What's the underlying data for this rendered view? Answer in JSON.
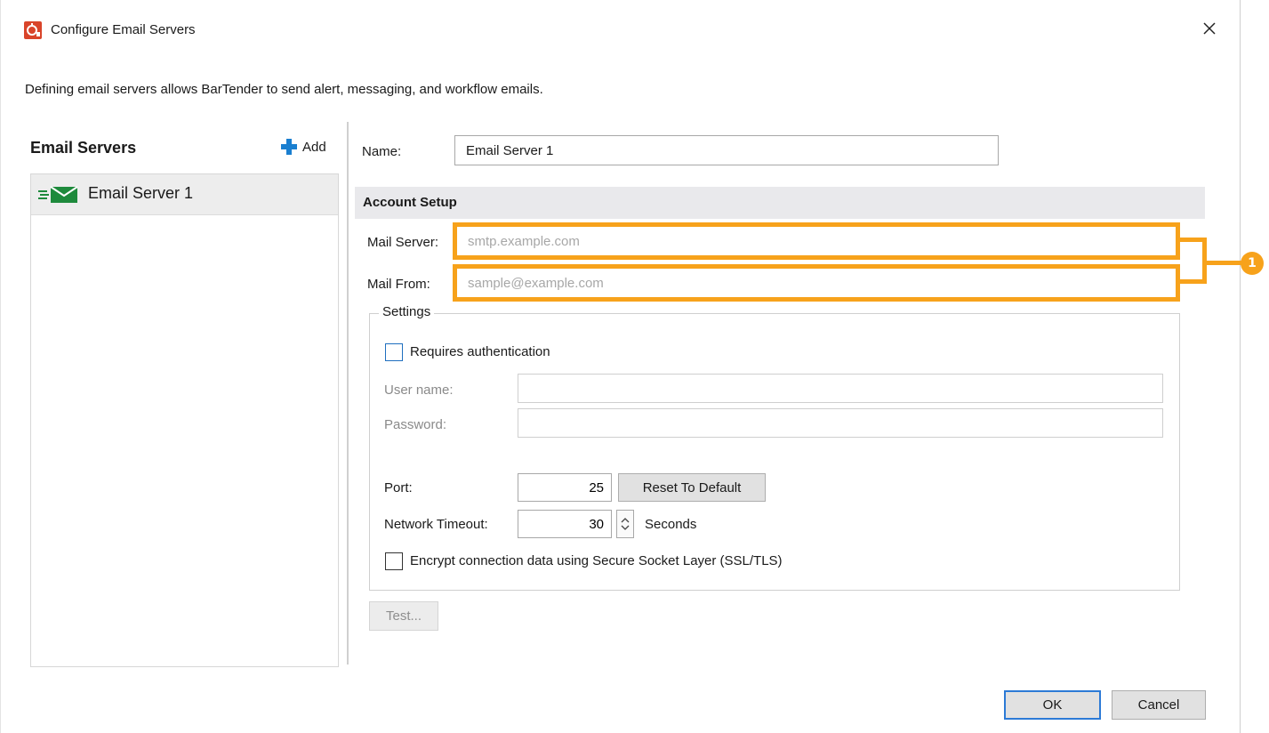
{
  "window": {
    "title": "Configure Email Servers",
    "description": "Defining email servers allows BarTender to send alert, messaging, and workflow emails."
  },
  "left_panel": {
    "heading": "Email Servers",
    "add_label": "Add",
    "servers": [
      {
        "label": "Email Server 1",
        "icon": "envelope-arrow-icon"
      }
    ]
  },
  "form": {
    "name_label": "Name:",
    "name_value": "Email Server 1",
    "section_title": "Account Setup",
    "mail_server_label": "Mail Server:",
    "mail_server_placeholder": "smtp.example.com",
    "mail_from_label": "Mail From:",
    "mail_from_placeholder": "sample@example.com"
  },
  "settings": {
    "legend": "Settings",
    "requires_auth_label": "Requires authentication",
    "requires_auth_checked": false,
    "username_label": "User name:",
    "password_label": "Password:",
    "port_label": "Port:",
    "port_value": "25",
    "reset_label": "Reset To Default",
    "timeout_label": "Network Timeout:",
    "timeout_value": "30",
    "timeout_unit": "Seconds",
    "ssl_label": "Encrypt connection data using Secure Socket Layer (SSL/TLS)",
    "ssl_checked": false
  },
  "buttons": {
    "test_label": "Test...",
    "ok_label": "OK",
    "cancel_label": "Cancel"
  },
  "callout": {
    "number": "1",
    "color": "#f7a21b"
  },
  "colors": {
    "accent_blue": "#1a7fd0",
    "app_icon_red": "#d9442a",
    "envelope_green": "#1e8a3c"
  }
}
